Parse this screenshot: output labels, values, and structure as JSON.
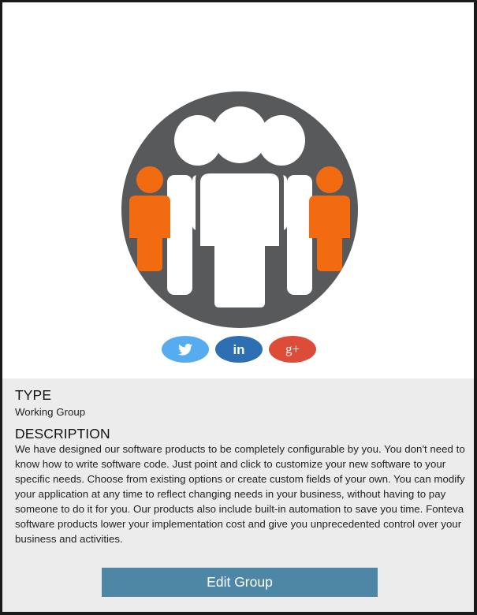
{
  "colors": {
    "logo_circle": "#58595b",
    "logo_figures": "#ffffff",
    "logo_accent": "#f26b10",
    "twitter": "#55acee",
    "linkedin": "#2e6fb4",
    "google_plus": "#dd4b39",
    "details_background": "#ececec",
    "button": "#4e86a6"
  },
  "social": {
    "buttons": [
      {
        "icon": "twitter-icon"
      },
      {
        "icon": "linkedin-icon",
        "label": "in"
      },
      {
        "icon": "google-plus-icon",
        "label": "g+"
      }
    ]
  },
  "details": {
    "type_heading": "TYPE",
    "type_value": "Working Group",
    "description_heading": "DESCRIPTION",
    "description_text": "We have designed our software products to be completely configurable by you. You don't need to know how to write software code. Just point and click to customize your new software to your specific needs. Choose from existing options or create custom fields of your own. You can modify your application at any time to reflect changing needs in your business, without having to pay someone to do it for you. Our products also include built-in automation to save you time. Fonteva software products lower your implementation cost and give you unprecedented control over your business and activities."
  },
  "actions": {
    "edit_label": "Edit Group"
  }
}
